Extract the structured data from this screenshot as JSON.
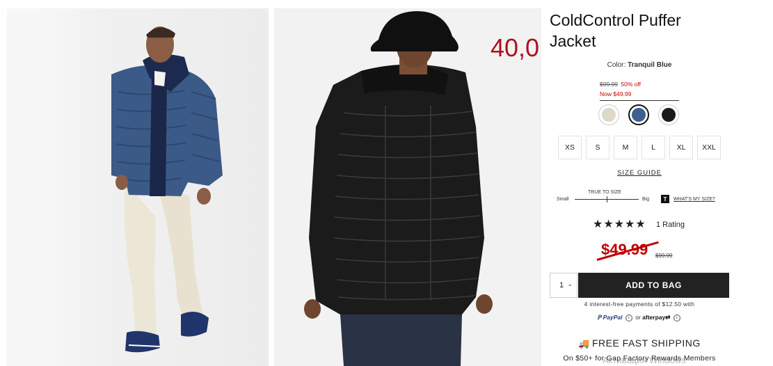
{
  "product": {
    "title": "ColdControl Puffer Jacket",
    "color_label": "Color:",
    "color_value": "Tranquil Blue",
    "mini_old_price": "$99.99",
    "mini_discount": "50% off",
    "mini_now_price": "Now $49.99"
  },
  "overlay_price": "40,0",
  "swatches": [
    {
      "name": "cream",
      "color": "#ddd8c8"
    },
    {
      "name": "tranquil-blue",
      "color": "#3e5f8f",
      "selected": true
    },
    {
      "name": "black",
      "color": "#1b1b1b"
    }
  ],
  "sizes": [
    "XS",
    "S",
    "M",
    "L",
    "XL",
    "XXL"
  ],
  "size_guide": "SIZE GUIDE",
  "fit": {
    "small": "Small",
    "big": "Big",
    "true_to_size": "TRUE TO SIZE",
    "logo": "T",
    "whats_my_size": "WHAT'S MY SIZE?",
    "level": 0.5
  },
  "rating": {
    "stars": "★★★★★",
    "count": "1 Rating",
    "value": 5
  },
  "price": {
    "current": "$49.99",
    "original": "$99.99"
  },
  "cart": {
    "qty": "1",
    "add_label": "ADD TO BAG"
  },
  "payments": {
    "installments": "4 interest-free payments of $12.50 with",
    "paypal": "PayPal",
    "or": "or",
    "afterpay": "afterpay"
  },
  "shipping": {
    "title": "FREE FAST SHIPPING",
    "sub": "On $50+ for Gap Factory Rewards Members"
  },
  "watermark": "Активация Windows",
  "colors": {
    "sale_red": "#c00000",
    "button_dark": "#222222"
  }
}
